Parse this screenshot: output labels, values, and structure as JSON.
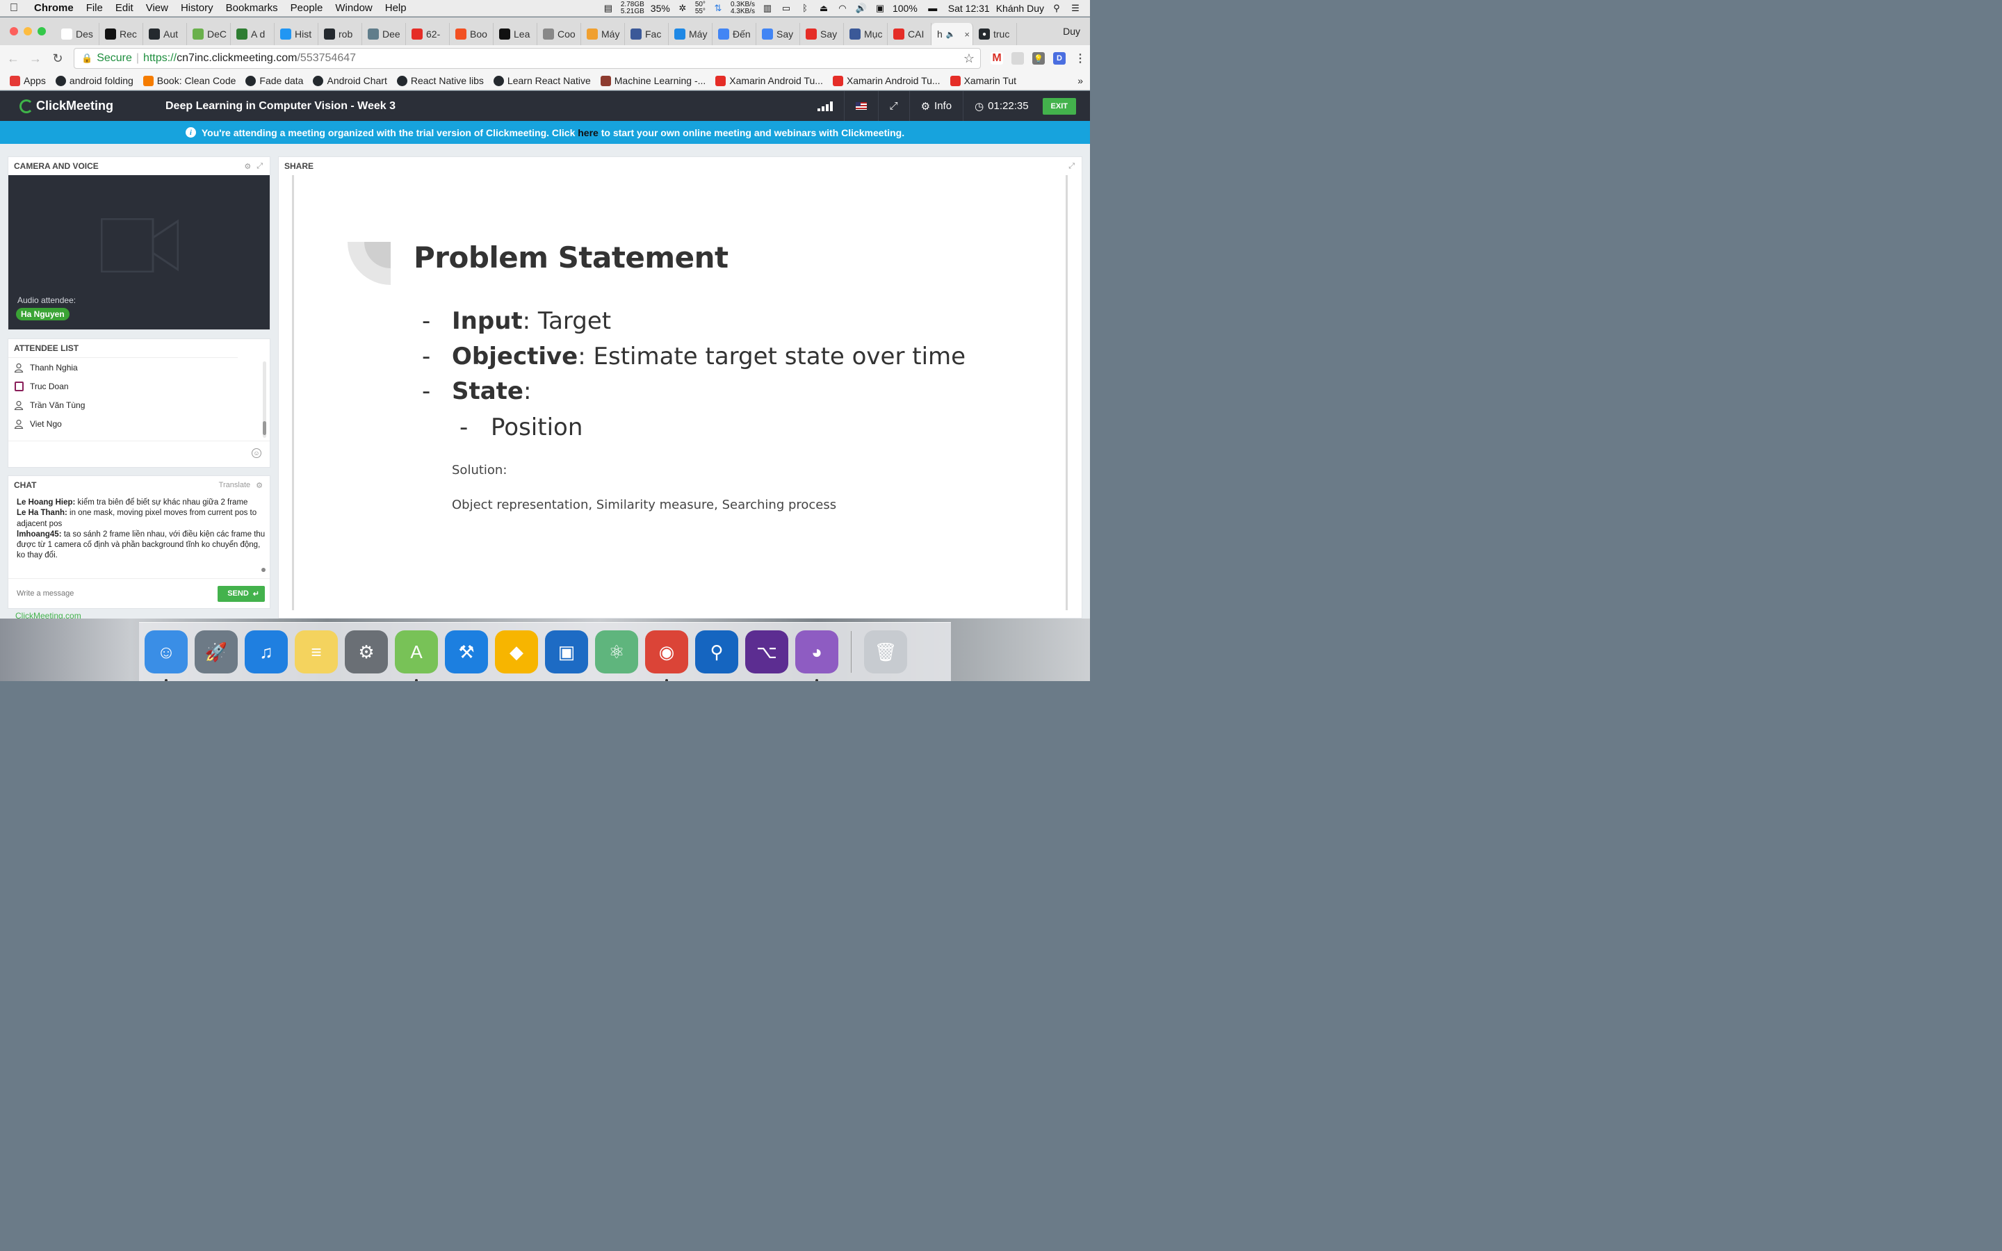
{
  "menubar": {
    "app": "Chrome",
    "items": [
      "File",
      "Edit",
      "View",
      "History",
      "Bookmarks",
      "People",
      "Window",
      "Help"
    ],
    "mem_used": "2.78GB",
    "mem_free": "5.21GB",
    "cpu": "35%",
    "temp1": "50°",
    "temp2": "55°",
    "net_up": "0.3KB/s",
    "net_down": "4.3KB/s",
    "battery": "100%",
    "clock": "Sat 12:31",
    "user": "Khánh Duy"
  },
  "tabs": [
    {
      "label": "Des",
      "color": "#ffffff",
      "icon": "google-drive-icon"
    },
    {
      "label": "Rec",
      "color": "#111111",
      "icon": "medium-icon"
    },
    {
      "label": "Aut",
      "color": "#24292e",
      "icon": "github-icon"
    },
    {
      "label": "DeC",
      "color": "#6ab04c",
      "icon": "emoji-icon"
    },
    {
      "label": "A d",
      "color": "#2e7d32",
      "icon": "asterisk-icon"
    },
    {
      "label": "Hist",
      "color": "#2196f3",
      "icon": "p-icon"
    },
    {
      "label": "rob",
      "color": "#24292e",
      "icon": "github-icon"
    },
    {
      "label": "Dee",
      "color": "#607d8b",
      "icon": "bird-icon"
    },
    {
      "label": "62-",
      "color": "#e52d27",
      "icon": "youtube-icon"
    },
    {
      "label": "Boo",
      "color": "#f25022",
      "icon": "microsoft-icon"
    },
    {
      "label": "Lea",
      "color": "#111111",
      "icon": "medium-icon"
    },
    {
      "label": "Coo",
      "color": "#888888",
      "icon": "info-icon"
    },
    {
      "label": "Máy",
      "color": "#f0a030",
      "icon": "b-icon"
    },
    {
      "label": "Fac",
      "color": "#3b5998",
      "icon": "facebook-icon"
    },
    {
      "label": "Máy",
      "color": "#1e88e5",
      "icon": "tiki-icon"
    },
    {
      "label": "Đến",
      "color": "#4285f4",
      "icon": "chrome-icon"
    },
    {
      "label": "Say",
      "color": "#4285f4",
      "icon": "plane-icon"
    },
    {
      "label": "Say",
      "color": "#e52d27",
      "icon": "youtube-icon"
    },
    {
      "label": "Mục",
      "color": "#3b5998",
      "icon": "facebook-icon"
    },
    {
      "label": "CAI",
      "color": "#e52d27",
      "icon": "youtube-icon"
    }
  ],
  "active_tab": {
    "label": "h",
    "close": "×"
  },
  "last_tab": {
    "label": "truc",
    "color": "#24292e",
    "icon": "github-icon"
  },
  "profile_name": "Duy",
  "address": {
    "secure": "Secure",
    "scheme": "https://",
    "host": "cn7inc.clickmeeting.com",
    "path": "/553754647"
  },
  "bookmarks": [
    {
      "label": "Apps",
      "color": "#e53935",
      "icon": "apps-grid-icon"
    },
    {
      "label": "android folding",
      "color": "#24292e",
      "icon": "github-icon"
    },
    {
      "label": "Book: Clean Code",
      "color": "#f57c00",
      "icon": "blogger-icon"
    },
    {
      "label": "Fade data",
      "color": "#24292e",
      "icon": "github-icon"
    },
    {
      "label": "Android Chart",
      "color": "#24292e",
      "icon": "github-icon"
    },
    {
      "label": "React Native libs",
      "color": "#24292e",
      "icon": "github-icon"
    },
    {
      "label": "Learn React Native",
      "color": "#24292e",
      "icon": "github-icon"
    },
    {
      "label": "Machine Learning -...",
      "color": "#8d3b2f",
      "icon": "image-icon"
    },
    {
      "label": "Xamarin Android Tu...",
      "color": "#e52d27",
      "icon": "youtube-icon"
    },
    {
      "label": "Xamarin Android Tu...",
      "color": "#e52d27",
      "icon": "youtube-icon"
    },
    {
      "label": "Xamarin Tut",
      "color": "#e52d27",
      "icon": "youtube-icon"
    }
  ],
  "cm": {
    "brand": "ClickMeeting",
    "meeting_title": "Deep Learning in Computer Vision - Week 3",
    "info_label": "Info",
    "timer": "01:22:35",
    "exit_label": "EXIT",
    "banner_before": "You're attending a meeting organized with the trial version of Clickmeeting. Click",
    "banner_link": "here",
    "banner_after": "to start your own online meeting and webinars with Clickmeeting.",
    "accent": "#43b24c",
    "banner_color": "#17a3dd"
  },
  "camera": {
    "title": "CAMERA AND VOICE",
    "audio_label": "Audio attendee:",
    "audio_name": "Ha Nguyen"
  },
  "attendees": {
    "title": "ATTENDEE LIST",
    "list": [
      {
        "name": "Thanh Nghia",
        "icon": "user-icon"
      },
      {
        "name": "Truc Doan",
        "icon": "tablet-icon"
      },
      {
        "name": "Trần Văn Tùng",
        "icon": "user-icon"
      },
      {
        "name": "Viet Ngo",
        "icon": "user-icon"
      }
    ]
  },
  "chat": {
    "title": "CHAT",
    "translate": "Translate",
    "messages": [
      {
        "author": "Le Hoang Hiep:",
        "text": " kiểm tra biên để biết sự khác nhau giữa 2 frame"
      },
      {
        "author": "Le Ha Thanh:",
        "text": " in one mask, moving pixel moves from current pos to adjacent pos"
      },
      {
        "author": "lmhoang45:",
        "text": " ta so sánh 2 frame liền nhau, với điều kiện các frame thu được từ 1 camera cố định và phần background tĩnh ko chuyển động, ko thay đổi."
      }
    ],
    "placeholder": "Write a message",
    "send_label": "SEND"
  },
  "powered_by": "ClickMeeting.com",
  "share": {
    "title": "SHARE",
    "slide_title": "Problem Statement",
    "bullets": [
      {
        "key": "Input",
        "value": " Target"
      },
      {
        "key": "Objective",
        "value": " Estimate target state over time"
      },
      {
        "key": "State",
        "value": ""
      }
    ],
    "sub_bullet": "Position",
    "dash": "-",
    "solution_label": "Solution:",
    "solution_text": "Object representation, Similarity measure, Searching process"
  },
  "dock": [
    {
      "name": "finder-icon",
      "color": "#3a8ee6",
      "glyph": "☺",
      "run": true
    },
    {
      "name": "launchpad-icon",
      "color": "#6d7a86",
      "glyph": "🚀",
      "run": false
    },
    {
      "name": "itunes-icon",
      "color": "#1f7fe0",
      "glyph": "♫",
      "run": false
    },
    {
      "name": "notes-icon",
      "color": "#f4d35e",
      "glyph": "≡",
      "run": false
    },
    {
      "name": "system-preferences-icon",
      "color": "#6a6f75",
      "glyph": "⚙",
      "run": false
    },
    {
      "name": "android-studio-icon",
      "color": "#78c257",
      "glyph": "A",
      "run": true
    },
    {
      "name": "xcode-icon",
      "color": "#1c7fe0",
      "glyph": "⚒",
      "run": false
    },
    {
      "name": "sketch-icon",
      "color": "#f7b500",
      "glyph": "◆",
      "run": false
    },
    {
      "name": "vmware-icon",
      "color": "#1d6bc4",
      "glyph": "▣",
      "run": false
    },
    {
      "name": "atom-icon",
      "color": "#5fb57d",
      "glyph": "⚛",
      "run": false
    },
    {
      "name": "chrome-icon",
      "color": "#db4437",
      "glyph": "◉",
      "run": true
    },
    {
      "name": "sourcetree-icon",
      "color": "#1565c0",
      "glyph": "⚲",
      "run": false
    },
    {
      "name": "visual-studio-icon",
      "color": "#5c2d91",
      "glyph": "⌥",
      "run": false
    },
    {
      "name": "github-desktop-icon",
      "color": "#8e5cc2",
      "glyph": "◕",
      "run": true
    }
  ],
  "trash": {
    "name": "trash-icon",
    "color": "#c7cbd0",
    "glyph": "🗑"
  }
}
